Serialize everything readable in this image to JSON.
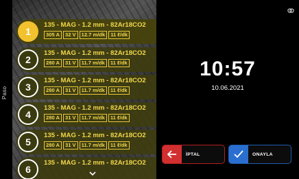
{
  "side_tab": {
    "label": "Paso"
  },
  "passes": [
    {
      "number": "1",
      "title": "135 - MAG - 1.2 mm - 82Ar18CO2",
      "chips": [
        "305 A",
        "32 V",
        "12.7 m/dk",
        "11 ℓ/dk"
      ],
      "active": true
    },
    {
      "number": "2",
      "title": "135 - MAG - 1.2 mm - 82Ar18CO2",
      "chips": [
        "280 A",
        "31 V",
        "11.7 m/dk",
        "11 ℓ/dk"
      ],
      "active": false
    },
    {
      "number": "3",
      "title": "135 - MAG - 1.2 mm - 82Ar18CO2",
      "chips": [
        "280 A",
        "31 V",
        "11.7 m/dk",
        "11 ℓ/dk"
      ],
      "active": false
    },
    {
      "number": "4",
      "title": "135 - MAG - 1.2 mm - 82Ar18CO2",
      "chips": [
        "280 A",
        "31 V",
        "11.7 m/dk",
        "11 ℓ/dk"
      ],
      "active": false
    },
    {
      "number": "5",
      "title": "135 - MAG - 1.2 mm - 82Ar18CO2",
      "chips": [
        "280 A",
        "31 V",
        "11.7 m/dk",
        "11 ℓ/dk"
      ],
      "active": false
    },
    {
      "number": "6",
      "title": "135 - MAG - 1.2 mm - 82Ar18CO2",
      "chips": [],
      "active": false
    }
  ],
  "scroll_icon": "chevron-down-icon",
  "clock": {
    "time": "10:57",
    "date": "10.06.2021"
  },
  "buttons": {
    "cancel": "İPTAL",
    "confirm": "ONAYLA"
  },
  "colors": {
    "accent_yellow": "#f2c12e",
    "cancel_red": "#d23030",
    "confirm_blue": "#2a6fd0"
  }
}
